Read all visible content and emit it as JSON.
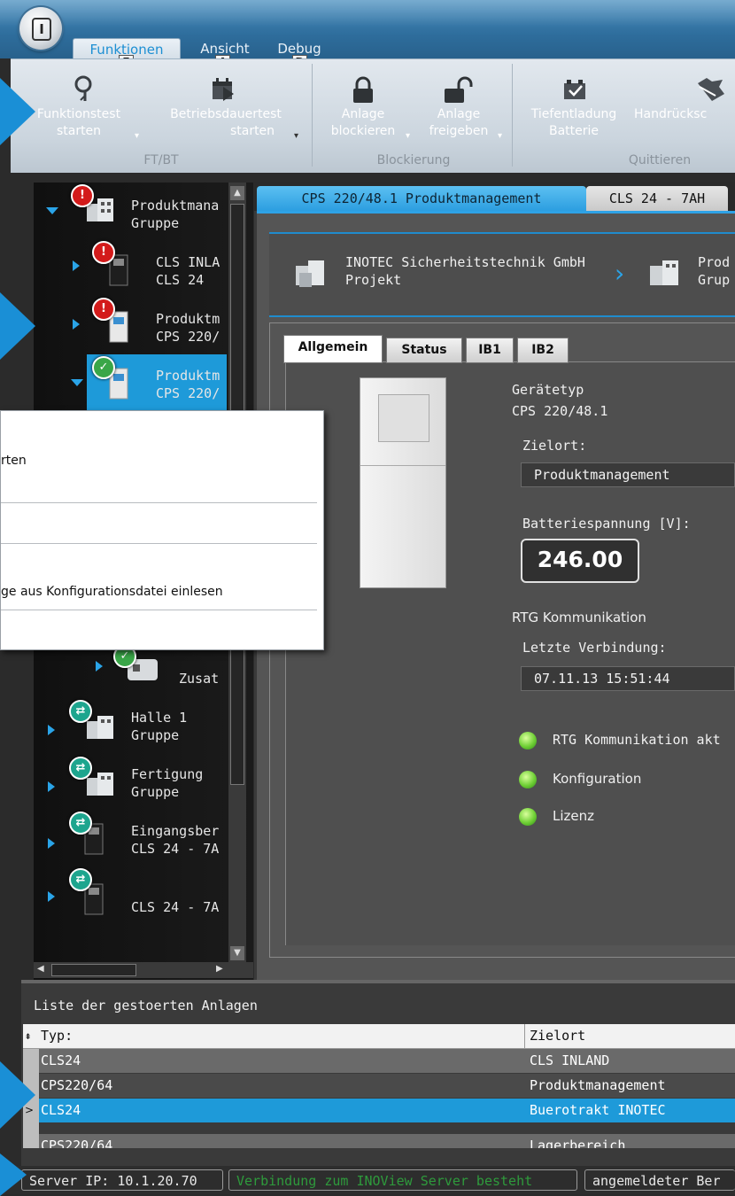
{
  "app_button": {
    "label": "I"
  },
  "ribbon_tabs": [
    {
      "label": "Funktionen",
      "key": "F",
      "active": true
    },
    {
      "label": "Ansicht",
      "key": "A"
    },
    {
      "label": "Debug",
      "key": "D"
    }
  ],
  "ribbon": {
    "groups": [
      {
        "label": "FT/BT",
        "buttons": [
          {
            "line1": "Funktionstest",
            "line2": "starten",
            "icon": "magnifier-icon"
          },
          {
            "line1": "Betriebsdauertest",
            "line2": "starten",
            "icon": "calendar-arrow-icon"
          }
        ]
      },
      {
        "label": "Blockierung",
        "buttons": [
          {
            "line1": "Anlage",
            "line2": "blockieren",
            "icon": "lock-closed-icon"
          },
          {
            "line1": "Anlage",
            "line2": "freigeben",
            "icon": "lock-open-icon"
          }
        ]
      },
      {
        "label": "Quittieren",
        "buttons": [
          {
            "line1": "Tiefentladung",
            "line2": "Batterie",
            "icon": "battery-check-icon"
          },
          {
            "line1": "Handrücksc",
            "line2": "",
            "icon": "hand-reset-icon"
          }
        ]
      }
    ]
  },
  "tree": {
    "nodes": [
      {
        "line1": "Produktmana",
        "line2": "Gruppe",
        "badge": "!",
        "status": "error"
      },
      {
        "line1": "CLS INLA",
        "line2": "CLS 24",
        "badge": "!",
        "status": "error"
      },
      {
        "line1": "Produktm",
        "line2": "CPS 220/",
        "badge": "!",
        "status": "error"
      },
      {
        "line1": "Produktm",
        "line2": "CPS 220/",
        "badge": "✓",
        "status": "ok"
      },
      {
        "line1": "Zusat",
        "line2": "",
        "badge": "✓",
        "status": "ok"
      },
      {
        "line1": "Halle 1",
        "line2": "Gruppe",
        "badge": "⇄",
        "status": "sync"
      },
      {
        "line1": "Fertigung",
        "line2": "Gruppe",
        "badge": "⇄",
        "status": "sync"
      },
      {
        "line1": "Eingangsber",
        "line2": "CLS 24 - 7A",
        "badge": "⇄",
        "status": "sync"
      },
      {
        "line1": "CLS 24 - 7A",
        "line2": "",
        "badge": "⇄",
        "status": "sync"
      }
    ]
  },
  "context_menu": {
    "items": [
      "rten",
      "",
      "",
      "ge aus Konfigurationsdatei einlesen",
      ""
    ]
  },
  "doc_tabs": [
    {
      "label": "CPS 220/48.1 Produktmanagement",
      "active": true
    },
    {
      "label": "CLS 24 - 7AH",
      "active": false
    }
  ],
  "breadcrumb": {
    "company": "INOTEC Sicherheitstechnik GmbH",
    "company_sub": "Projekt",
    "group": "Prod",
    "group_sub": "Grup"
  },
  "sub_tabs": [
    "Allgemein",
    "Status",
    "IB1",
    "IB2"
  ],
  "device": {
    "geraetetyp_label": "Gerätetyp",
    "geraetetyp_value": "CPS 220/48.1",
    "zielort_label": "Zielort:",
    "zielort_value": "Produktmanagement",
    "battery_label": "Batteriespannung [V]:",
    "battery_value": "246.00",
    "rtg_label": "RTG Kommunikation",
    "last_conn_label": "Letzte Verbindung:",
    "last_conn_value": "07.11.13 15:51:44",
    "leds": [
      {
        "label": "RTG Kommunikation akt"
      },
      {
        "label": "Konfiguration"
      },
      {
        "label": "Lizenz"
      }
    ]
  },
  "fault_list": {
    "title": "Liste der gestoerten Anlagen",
    "columns": [
      "Typ:",
      "Zielort"
    ],
    "rows": [
      {
        "typ": "CLS24",
        "zielort": "CLS INLAND"
      },
      {
        "typ": "CPS220/64",
        "zielort": "Produktmanagement"
      },
      {
        "typ": "CLS24",
        "zielort": "Buerotrakt INOTEC",
        "selected": true
      },
      {
        "typ": "CPS220/64",
        "zielort": "Lagerbereich"
      }
    ]
  },
  "status_bar": {
    "server_ip": "Server IP: 10.1.20.70",
    "connection": "Verbindung zum INOView Server besteht",
    "user": "angemeldeter Ber"
  },
  "colors": {
    "accent": "#1a8fd6",
    "selected_row": "#1e9ad9",
    "connection_text": "#2e9a3c",
    "led_green": "#6fcf35"
  }
}
